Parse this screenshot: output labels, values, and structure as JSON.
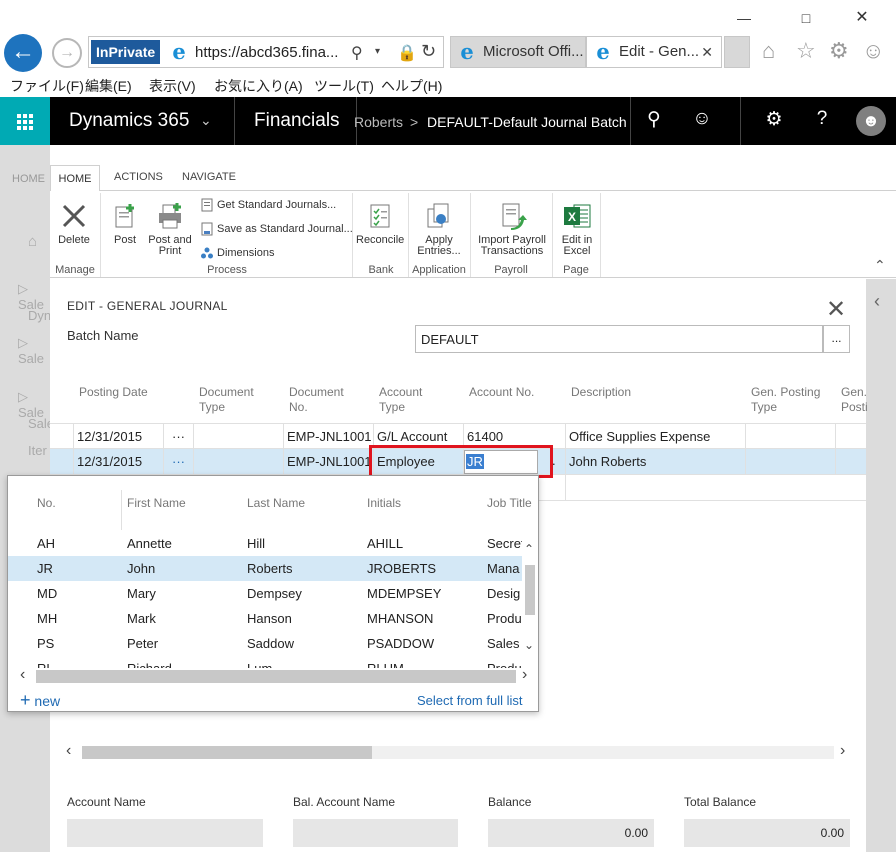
{
  "browser": {
    "inprivate_label": "InPrivate",
    "url": "https://abcd365.fina...",
    "tabs": [
      {
        "label": "Microsoft Offi..."
      },
      {
        "label": "Edit - Gen..."
      }
    ],
    "menu": [
      "ファイル(F)",
      "編集(E)",
      "表示(V)",
      "お気に入り(A)",
      "ツール(T)",
      "ヘルプ(H)"
    ]
  },
  "topbar": {
    "app_name": "Dynamics 365",
    "module": "Financials",
    "breadcrumb_prev": "Roberts",
    "breadcrumb_sep": ">",
    "breadcrumb_current": "DEFAULT-Default Journal Batch",
    "accent": "#00aab4"
  },
  "bg_nav": {
    "home_tab": "HOME",
    "items": [
      "Sale",
      "Dyn",
      "Sale",
      "Sale",
      "Sale",
      "Iter"
    ]
  },
  "ribbon": {
    "tabs": [
      "HOME",
      "ACTIONS",
      "NAVIGATE"
    ],
    "buttons": {
      "delete": "Delete",
      "post": "Post",
      "post_and_print_1": "Post and",
      "post_and_print_2": "Print",
      "get_standard": "Get Standard Journals...",
      "save_standard": "Save as Standard Journal...",
      "dimensions": "Dimensions",
      "reconcile": "Reconcile",
      "apply_1": "Apply",
      "apply_2": "Entries...",
      "import_1": "Import Payroll",
      "import_2": "Transactions",
      "excel_1": "Edit in",
      "excel_2": "Excel"
    },
    "groups": {
      "manage": "Manage",
      "process": "Process",
      "bank": "Bank",
      "application": "Application",
      "payroll": "Payroll",
      "page": "Page"
    }
  },
  "page": {
    "heading": "EDIT - GENERAL JOURNAL",
    "batch_label": "Batch Name",
    "batch_value": "DEFAULT",
    "batch_lookup": "...",
    "columns": {
      "posting_date": "Posting Date",
      "doc_type_1": "Document",
      "doc_type_2": "Type",
      "doc_no_1": "Document",
      "doc_no_2": "No.",
      "acct_type_1": "Account",
      "acct_type_2": "Type",
      "acct_no": "Account No.",
      "description": "Description",
      "gen_post_type_1": "Gen. Posting",
      "gen_post_type_2": "Type",
      "gen_post_2_1": "Gen.",
      "gen_post_2_2": "Posti"
    },
    "rows": [
      {
        "date": "12/31/2015",
        "menu": "···",
        "doc_type": "",
        "doc_no": "EMP-JNL1001",
        "acct_type": "G/L Account",
        "acct_no": "61400",
        "description": "Office Supplies Expense"
      },
      {
        "date": "12/31/2015",
        "menu": "···",
        "doc_type": "",
        "doc_no": "EMP-JNL1001",
        "acct_type": "Employee",
        "acct_no": "JR",
        "description": "John Roberts"
      }
    ],
    "edit_ellipsis": ".",
    "footer": {
      "account_name": "Account Name",
      "bal_account_name": "Bal. Account Name",
      "balance": "Balance",
      "balance_value": "0.00",
      "total_balance": "Total Balance",
      "total_balance_value": "0.00"
    }
  },
  "lookup": {
    "columns": [
      "No.",
      "First Name",
      "Last Name",
      "Initials",
      "Job Title"
    ],
    "rows": [
      {
        "no": "AH",
        "first": "Annette",
        "last": "Hill",
        "initials": "AHILL",
        "job": "Secret"
      },
      {
        "no": "JR",
        "first": "John",
        "last": "Roberts",
        "initials": "JROBERTS",
        "job": "Mana"
      },
      {
        "no": "MD",
        "first": "Mary",
        "last": "Dempsey",
        "initials": "MDEMPSEY",
        "job": "Desig"
      },
      {
        "no": "MH",
        "first": "Mark",
        "last": "Hanson",
        "initials": "MHANSON",
        "job": "Produ"
      },
      {
        "no": "PS",
        "first": "Peter",
        "last": "Saddow",
        "initials": "PSADDOW",
        "job": "Sales"
      },
      {
        "no": "RL",
        "first": "Richard",
        "last": "Lum",
        "initials": "RLUM",
        "job": "Produ"
      }
    ],
    "new_label": "new",
    "select_full": "Select from full list",
    "selected_color": "#d4e8f6"
  }
}
